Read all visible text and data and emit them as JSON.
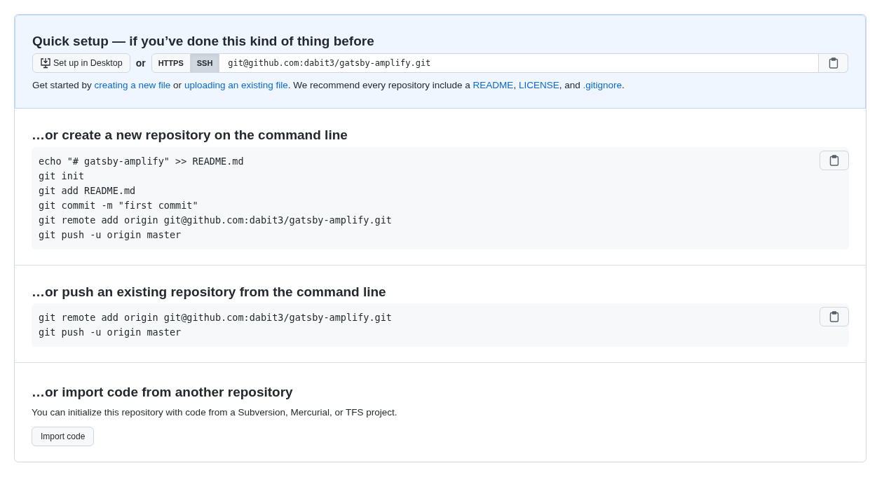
{
  "quick_setup": {
    "title": "Quick setup — if you’ve done this kind of thing before",
    "desktop_button": "Set up in Desktop",
    "or": "or",
    "protocols": [
      {
        "label": "HTTPS",
        "selected": false
      },
      {
        "label": "SSH",
        "selected": true
      }
    ],
    "clone_url": "git@github.com:dabit3/gatsby-amplify.git",
    "intro": [
      {
        "kind": "text",
        "text": "Get started by "
      },
      {
        "kind": "link",
        "text": "creating a new file"
      },
      {
        "kind": "text",
        "text": " or "
      },
      {
        "kind": "link",
        "text": "uploading an existing file"
      },
      {
        "kind": "text",
        "text": ". We recommend every repository include a "
      },
      {
        "kind": "link",
        "text": "README"
      },
      {
        "kind": "text",
        "text": ", "
      },
      {
        "kind": "link",
        "text": "LICENSE"
      },
      {
        "kind": "text",
        "text": ", and "
      },
      {
        "kind": "link",
        "text": ".gitignore"
      },
      {
        "kind": "text",
        "text": "."
      }
    ]
  },
  "sections": [
    {
      "kind": "code",
      "title": "…or create a new repository on the command line",
      "lines": [
        "echo \"# gatsby-amplify\" >> README.md",
        "git init",
        "git add README.md",
        "git commit -m \"first commit\"",
        "git remote add origin git@github.com:dabit3/gatsby-amplify.git",
        "git push -u origin master"
      ]
    },
    {
      "kind": "code",
      "title": "…or push an existing repository from the command line",
      "lines": [
        "git remote add origin git@github.com:dabit3/gatsby-amplify.git",
        "git push -u origin master"
      ]
    },
    {
      "kind": "import",
      "title": "…or import code from another repository",
      "text": "You can initialize this repository with code from a Subversion, Mercurial, or TFS project.",
      "button": "Import code"
    }
  ]
}
